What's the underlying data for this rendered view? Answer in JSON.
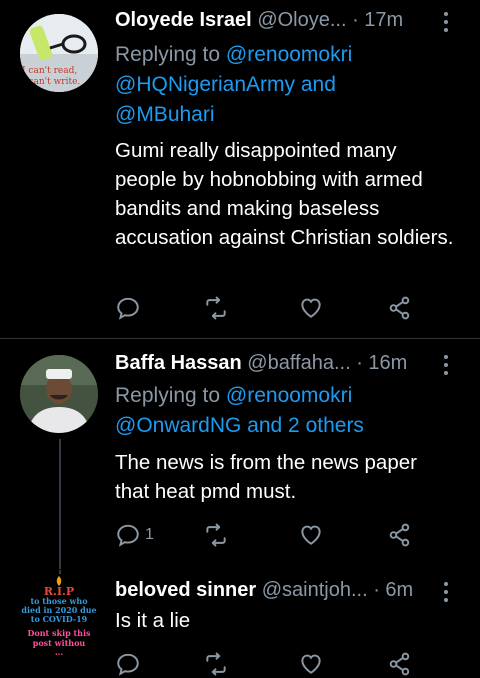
{
  "tweets": [
    {
      "name": "Oloyede  Israel",
      "handle": "@Oloye...",
      "time": "· 17m",
      "reply_prefix": "Replying to",
      "reply_mentions": [
        "@renoomokri",
        "@HQNigerianArmy and",
        "@MBuhari"
      ],
      "text": "Gumi really disappointed many people by hobnobbing with armed bandits and making  baseless accusation against Christian soldiers.",
      "avatar_text": [
        "I can't read,",
        "I can't write."
      ],
      "actions": {
        "reply_count": "",
        "retweet_count": "",
        "like_count": ""
      }
    },
    {
      "name": "Baffa Hassan",
      "handle": "@baffaha...",
      "time": "· 16m",
      "reply_prefix": "Replying to",
      "reply_mentions": [
        "@renoomokri",
        "@OnwardNG and 2 others"
      ],
      "text": "The news is from the news paper that heat pmd must.",
      "actions": {
        "reply_count": "1",
        "retweet_count": "",
        "like_count": ""
      }
    },
    {
      "name": "beloved sinner",
      "handle": "@saintjoh...",
      "time": "· 6m",
      "text": "Is it a lie",
      "avatar_text": [
        "R.I.P",
        "to those who",
        "died in 2020 due",
        "to COVID-19",
        "Dont skip this",
        "post withou",
        "..."
      ]
    }
  ],
  "colors": {
    "background": "#000000",
    "text": "#ffffff",
    "muted": "#8b98a5",
    "link": "#1d9bf0",
    "divider": "#2f3336"
  }
}
